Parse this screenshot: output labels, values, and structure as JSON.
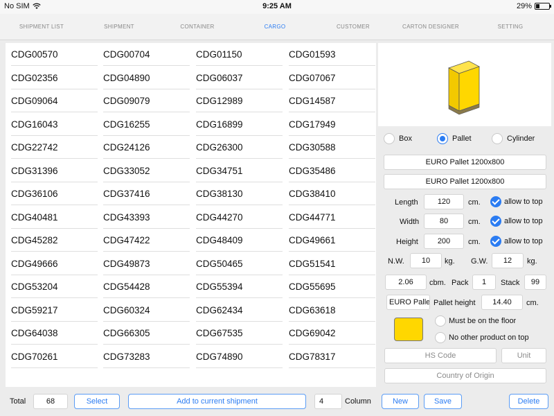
{
  "status_bar": {
    "carrier": "No SIM",
    "time": "9:25 AM",
    "battery": "29%",
    "battery_level": 0.29
  },
  "tabs": [
    {
      "label": "SHIPMENT LIST",
      "active": false
    },
    {
      "label": "SHIPMENT",
      "active": false
    },
    {
      "label": "CONTAINER",
      "active": false
    },
    {
      "label": "CARGO",
      "active": true
    },
    {
      "label": "CUSTOMER",
      "active": false
    },
    {
      "label": "CARTON DESIGNER",
      "active": false
    },
    {
      "label": "SETTING",
      "active": false
    }
  ],
  "cargo_rows": [
    [
      "CDG00570",
      "CDG00704",
      "CDG01150",
      "CDG01593"
    ],
    [
      "CDG02356",
      "CDG04890",
      "CDG06037",
      "CDG07067"
    ],
    [
      "CDG09064",
      "CDG09079",
      "CDG12989",
      "CDG14587"
    ],
    [
      "CDG16043",
      "CDG16255",
      "CDG16899",
      "CDG17949"
    ],
    [
      "CDG22742",
      "CDG24126",
      "CDG26300",
      "CDG30588"
    ],
    [
      "CDG31396",
      "CDG33052",
      "CDG34751",
      "CDG35486"
    ],
    [
      "CDG36106",
      "CDG37416",
      "CDG38130",
      "CDG38410"
    ],
    [
      "CDG40481",
      "CDG43393",
      "CDG44270",
      "CDG44771"
    ],
    [
      "CDG45282",
      "CDG47422",
      "CDG48409",
      "CDG49661"
    ],
    [
      "CDG49666",
      "CDG49873",
      "CDG50465",
      "CDG51541"
    ],
    [
      "CDG53204",
      "CDG54428",
      "CDG55394",
      "CDG55695"
    ],
    [
      "CDG59217",
      "CDG60324",
      "CDG62434",
      "CDG63618"
    ],
    [
      "CDG64038",
      "CDG66305",
      "CDG67535",
      "CDG69042"
    ],
    [
      "CDG70261",
      "CDG73283",
      "CDG74890",
      "CDG78317"
    ]
  ],
  "panel": {
    "shape_options": [
      {
        "label": "Box",
        "selected": false
      },
      {
        "label": "Pallet",
        "selected": true
      },
      {
        "label": "Cylinder",
        "selected": false
      }
    ],
    "pallet_type_1": "EURO Pallet 1200x800",
    "pallet_type_2": "EURO Pallet 1200x800",
    "length": {
      "label": "Length",
      "value": "120",
      "unit": "cm.",
      "check_label": "allow to top"
    },
    "width": {
      "label": "Width",
      "value": "80",
      "unit": "cm.",
      "check_label": "allow to top"
    },
    "height": {
      "label": "Height",
      "value": "200",
      "unit": "cm.",
      "check_label": "allow to top"
    },
    "nw": {
      "label": "N.W.",
      "value": "10",
      "unit": "kg."
    },
    "gw": {
      "label": "G.W.",
      "value": "12",
      "unit": "kg."
    },
    "cbm": {
      "value": "2.06",
      "unit": "cbm."
    },
    "pack": {
      "label": "Pack",
      "value": "1"
    },
    "stack": {
      "label": "Stack",
      "value": "99"
    },
    "pallet_name": "EURO Pallet",
    "pallet_height": {
      "label": "Pallet height",
      "value": "14.40",
      "unit": "cm."
    },
    "color": "#FFD700",
    "floor_option": "Must be on the floor",
    "top_option": "No other product on top",
    "hs_code_placeholder": "HS Code",
    "unit_placeholder": "Unit",
    "origin_placeholder": "Country of Origin"
  },
  "bottom": {
    "total_label": "Total",
    "total_value": "68",
    "select_label": "Select",
    "add_label": "Add to current shipment",
    "column_value": "4",
    "column_label": "Column",
    "new_label": "New",
    "save_label": "Save",
    "delete_label": "Delete"
  },
  "colors": {
    "accent": "#2B7CF2",
    "cargo_color": "#FFD700"
  }
}
